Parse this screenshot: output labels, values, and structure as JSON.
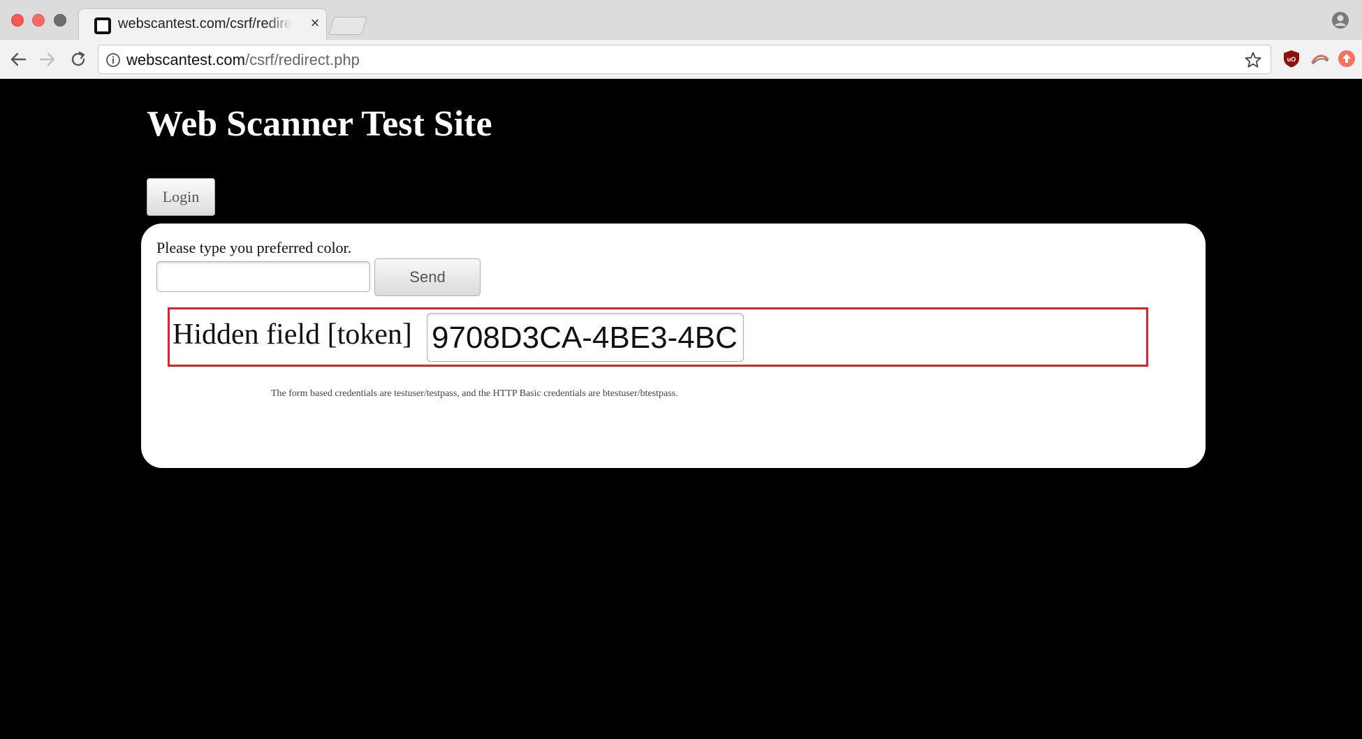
{
  "browser": {
    "tab": {
      "title": "webscantest.com/csrf/redirect.php",
      "close_glyph": "×",
      "favicon": "square-favicon-icon"
    },
    "url": {
      "host": "webscantest.com",
      "path": "/csrf/redirect.php"
    },
    "icons": {
      "back": "arrow-left-icon",
      "forward": "arrow-right-icon",
      "reload": "reload-icon",
      "info": "info-icon",
      "bookmark": "star-icon",
      "profile": "person-icon",
      "ext_ublock": "ublock-origin-icon",
      "ext_second": "swoosh-extension-icon",
      "ext_third": "orange-upload-extension-icon"
    },
    "colors": {
      "chrome_tabstrip": "#dcdcdc",
      "chrome_toolbar": "#f2f2f2",
      "ublock_red": "#8b1111",
      "ext_orange": "#f4735a"
    }
  },
  "page": {
    "site_title": "Web Scanner Test Site",
    "login_button": "Login",
    "form": {
      "prompt": "Please type you preferred color.",
      "color_input_value": "",
      "send_button": "Send"
    },
    "hidden_field": {
      "label": "Hidden field [token]",
      "value": "9708D3CA-4BE3-4BC"
    },
    "credentials_note": "The form based credentials are testuser/testpass, and the HTTP Basic credentials are btestuser/btestpass.",
    "colors": {
      "background": "#000000",
      "panel": "#ffffff",
      "highlight_border": "#e0202a"
    }
  }
}
